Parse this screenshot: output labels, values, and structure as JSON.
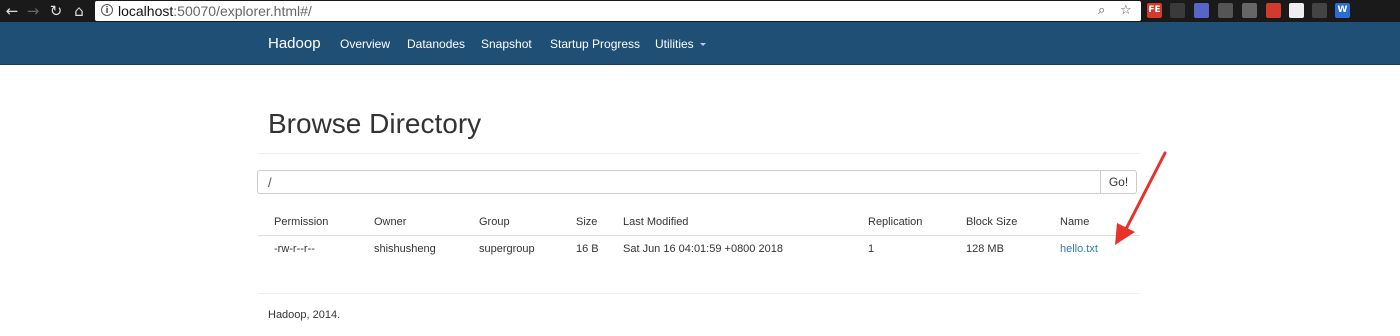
{
  "browser": {
    "url_host": "localhost",
    "url_rest": ":50070/explorer.html#/",
    "extensions": [
      {
        "name": "fe-extension-icon",
        "label": "FE",
        "color": "#d23a2b"
      },
      {
        "name": "extension-box-icon",
        "label": "",
        "color": "#3a3a3a"
      },
      {
        "name": "extension-hex-icon",
        "label": "",
        "color": "#5865c7"
      },
      {
        "name": "extension-bulb-icon",
        "label": "",
        "color": "#555"
      },
      {
        "name": "extension-image-icon",
        "label": "",
        "color": "#666"
      },
      {
        "name": "extension-pin-icon",
        "label": "",
        "color": "#d23a2b"
      },
      {
        "name": "extension-text-icon",
        "label": "",
        "color": "#eee"
      },
      {
        "name": "extension-umbrella-icon",
        "label": "",
        "color": "#444"
      },
      {
        "name": "extension-w-icon",
        "label": "W",
        "color": "#2b6cd6"
      },
      {
        "name": "extension-react-icon",
        "label": "",
        "color": "#1a1a1a"
      }
    ]
  },
  "navbar": {
    "brand": "Hadoop",
    "links": [
      "Overview",
      "Datanodes",
      "Snapshot",
      "Startup Progress",
      "Utilities"
    ]
  },
  "page": {
    "title": "Browse Directory",
    "path_value": "/",
    "go_label": "Go!"
  },
  "table": {
    "headers": [
      "Permission",
      "Owner",
      "Group",
      "Size",
      "Last Modified",
      "Replication",
      "Block Size",
      "Name"
    ],
    "rows": [
      [
        "-rw-r--r--",
        "shishusheng",
        "supergroup",
        "16 B",
        "Sat Jun 16 04:01:59 +0800 2018",
        "1",
        "128 MB",
        "hello.txt"
      ]
    ]
  },
  "footer": "Hadoop, 2014.",
  "colors": {
    "navbar": "#1f4f75",
    "link": "#337ab7",
    "arrow": "#e8312a"
  }
}
